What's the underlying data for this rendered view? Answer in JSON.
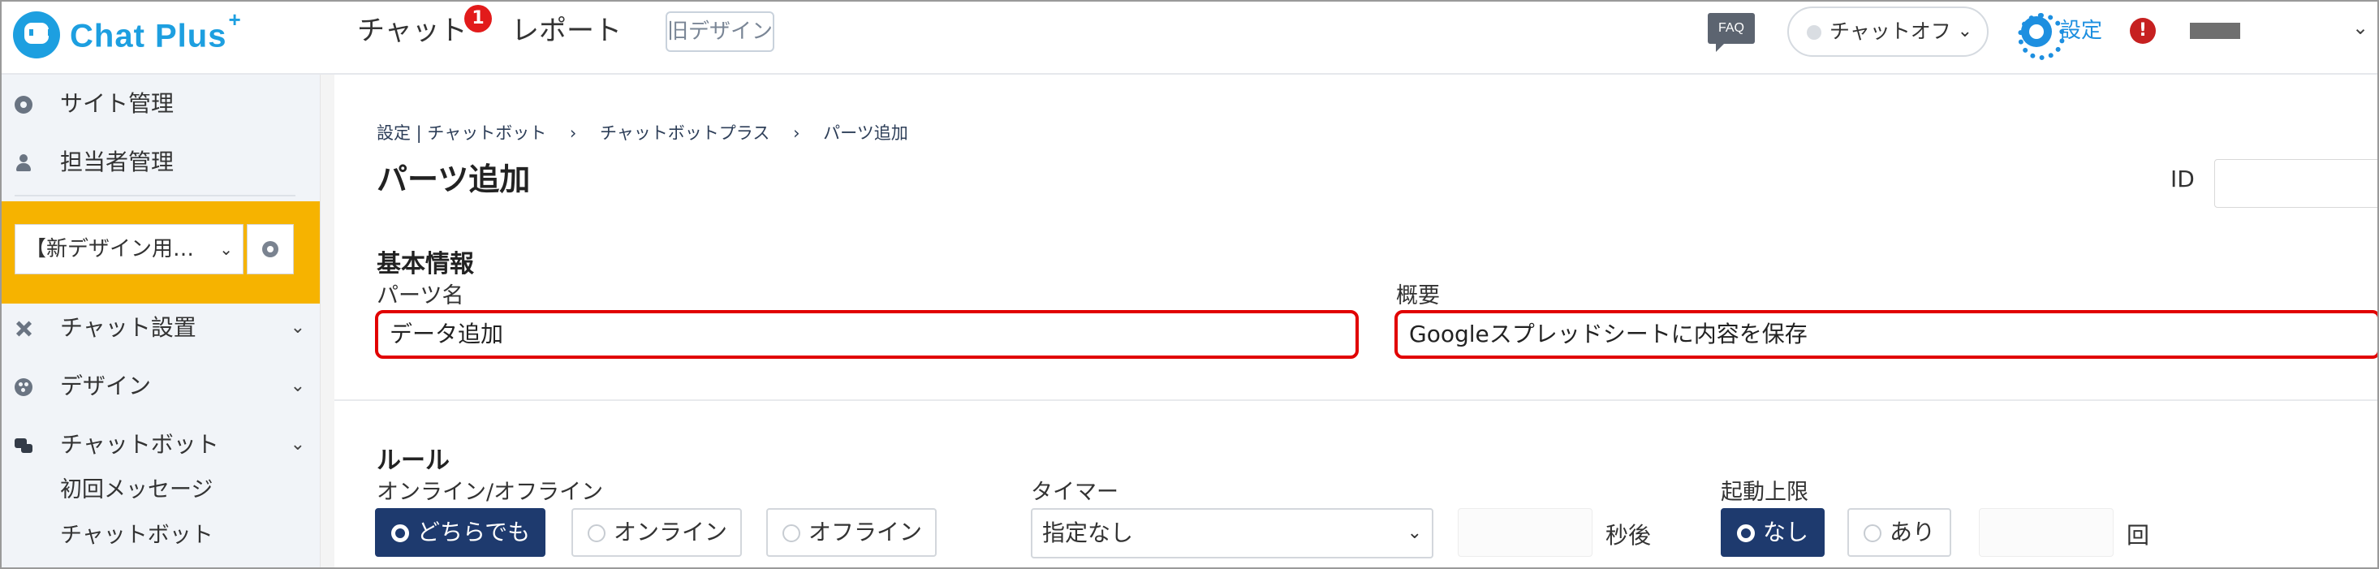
{
  "app": {
    "logo_text": "Chat Plus",
    "logo_plus": "+"
  },
  "topnav": {
    "chat_label": "チャット",
    "chat_badge": "1",
    "report_label": "レポート",
    "old_design_label": "旧デザイン",
    "faq_label": "FAQ",
    "chat_status_label": "チャットオフ",
    "settings_label": "設定",
    "alert_glyph": "!"
  },
  "sidebar": {
    "site_admin": "サイト管理",
    "staff_admin": "担当者管理",
    "site_select_value": "【新デザイン用…",
    "items": [
      {
        "label": "チャット設置",
        "icon": "tools-icon"
      },
      {
        "label": "デザイン",
        "icon": "palette-icon"
      },
      {
        "label": "チャットボット",
        "icon": "chat-bubbles-icon"
      }
    ],
    "sub_items": [
      "初回メッセージ",
      "チャットボット"
    ]
  },
  "breadcrumb": [
    "設定 | チャットボット",
    "›",
    "チャットボットプラス",
    "›",
    "パーツ追加"
  ],
  "page_title": "パーツ追加",
  "id_label": "ID",
  "basic_info": {
    "heading": "基本情報",
    "parts_name_label": "パーツ名",
    "parts_name_value": "データ追加",
    "summary_label": "概要",
    "summary_value": "Googleスプレッドシートに内容を保存"
  },
  "rules": {
    "heading": "ルール",
    "online_label": "オンライン/オフライン",
    "online_options": [
      "どちらでも",
      "オンライン",
      "オフライン"
    ],
    "online_selected": "どちらでも",
    "timer_label": "タイマー",
    "timer_value": "指定なし",
    "seconds_after": "秒後",
    "limit_label": "起動上限",
    "limit_options": [
      "なし",
      "あり"
    ],
    "limit_selected": "なし",
    "times_unit": "回"
  },
  "colors": {
    "brand": "#1d9fe0",
    "highlight_box": "#f6b300",
    "active_button": "#1e3a6e",
    "annotation_red": "#e10000"
  }
}
